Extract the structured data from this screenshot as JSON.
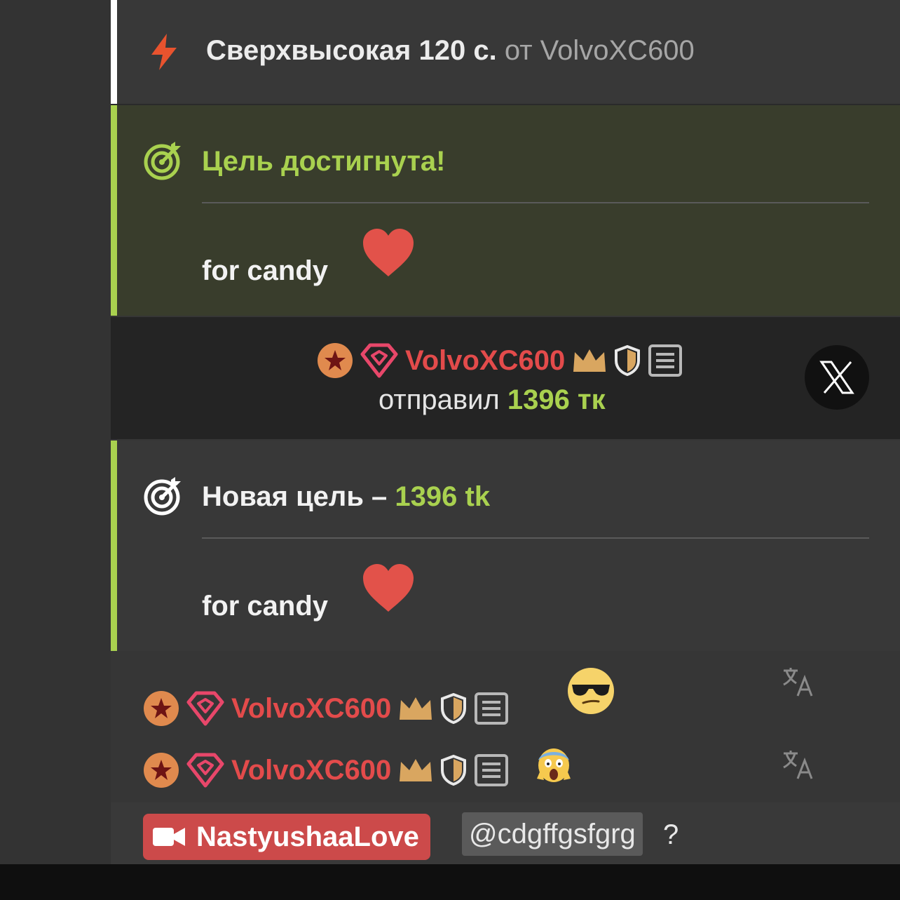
{
  "boost": {
    "title": "Сверхвысокая 120 с.",
    "from_text": "от VolvoXC600",
    "icon": "lightning-icon"
  },
  "goal_reached": {
    "title": "Цель достигнута!",
    "description": "for candy",
    "icon": "target-icon",
    "emoji": "heart-icon"
  },
  "tip": {
    "username": "VolvoXC600",
    "action": "отправил",
    "amount": "1396 тк",
    "badges": [
      "star-badge-icon",
      "diamond-badge-icon",
      "crown-icon",
      "shield-icon",
      "notes-icon"
    ]
  },
  "goal_new": {
    "title_prefix": "Новая цель –",
    "amount": "1396 tk",
    "description": "for candy",
    "icon": "target-icon",
    "emoji": "heart-icon"
  },
  "messages": [
    {
      "username": "VolvoXC600",
      "emoji": "sunglasses-emoji"
    },
    {
      "username": "VolvoXC600",
      "emoji": "scream-emoji"
    }
  ],
  "mention_line": {
    "cam_label": "NastyushaaLove",
    "mention": "@cdgffgsfgrg",
    "suffix": "?"
  },
  "colors": {
    "accent_green": "#a9d14f",
    "username_red": "#e34b4b",
    "boost_orange": "#e8532e",
    "crown_gold": "#d9a660",
    "badge_orange": "#e08a4e",
    "cam_red": "#cc4a4a"
  }
}
